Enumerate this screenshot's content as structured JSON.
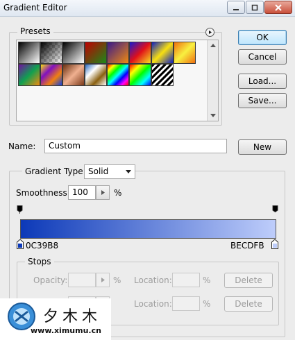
{
  "window": {
    "title": "Gradient Editor",
    "minimize_icon": "minimize-icon",
    "maximize_icon": "maximize-icon",
    "close_icon": "close-icon"
  },
  "presets": {
    "label": "Presets",
    "menu_icon": "flyout-arrow-icon",
    "swatches": [
      {
        "name": "foreground-to-background",
        "colors": [
          "#000000",
          "#ffffff"
        ]
      },
      {
        "name": "foreground-to-transparent",
        "colors": [
          "#000000",
          "transparent"
        ]
      },
      {
        "name": "black-white",
        "colors": [
          "#000000",
          "#ffffff"
        ]
      },
      {
        "name": "red-green",
        "colors": [
          "#c00000",
          "#1a8a1a"
        ]
      },
      {
        "name": "violet-orange",
        "colors": [
          "#3a1a8a",
          "#f08a10"
        ]
      },
      {
        "name": "blue-red-yellow",
        "colors": [
          "#1a1ad0",
          "#e0101a",
          "#f8e020"
        ]
      },
      {
        "name": "blue-yellow-blue",
        "colors": [
          "#1020c0",
          "#f8e010",
          "#1020c0"
        ]
      },
      {
        "name": "orange-yellow-orange",
        "colors": [
          "#f07010",
          "#f8f040",
          "#f07010"
        ]
      },
      {
        "name": "violet-green-orange",
        "colors": [
          "#7010a0",
          "#10a050",
          "#f08a10"
        ]
      },
      {
        "name": "yellow-violet-orange-blue",
        "colors": [
          "#f8e010",
          "#8010c0",
          "#f08010",
          "#1040e0"
        ]
      },
      {
        "name": "copper",
        "colors": [
          "#6a3010",
          "#f0b090",
          "#7a3818"
        ]
      },
      {
        "name": "chrome",
        "colors": [
          "#2a6ac0",
          "#ffffff",
          "#8a6010",
          "#ffffff"
        ]
      },
      {
        "name": "spectrum",
        "colors": [
          "#ff0000",
          "#ffff00",
          "#00ff00",
          "#00ffff",
          "#0000ff",
          "#ff00ff",
          "#ff0000"
        ]
      },
      {
        "name": "transparent-rainbow",
        "colors": [
          "#ff0000",
          "#ffff00",
          "#00ff00",
          "#00ffff",
          "#0000ff"
        ]
      },
      {
        "name": "transparent-stripes",
        "colors": [
          "#000000",
          "#ffffff"
        ]
      }
    ]
  },
  "buttons": {
    "ok": "OK",
    "cancel": "Cancel",
    "load": "Load...",
    "save": "Save...",
    "new": "New",
    "delete_opacity": "Delete",
    "delete_color": "Delete"
  },
  "name_field": {
    "label": "Name:",
    "value": "Custom"
  },
  "gradient_type": {
    "label": "Gradient Type:",
    "value": "Solid"
  },
  "smoothness": {
    "label": "Smoothness:",
    "value": "100",
    "unit": "%"
  },
  "gradient": {
    "start_color": "#0C39B8",
    "end_color": "#BECDFB",
    "start_label": "0C39B8",
    "end_label": "BECDFB"
  },
  "stops": {
    "label": "Stops",
    "opacity_label": "Opacity:",
    "opacity_unit": "%",
    "location_label_1": "Location:",
    "location_unit_1": "%",
    "location_label_2": "Location:",
    "location_unit_2": "%"
  },
  "watermark": {
    "text_cn": "夕木木",
    "url": "www.ximumu.cn"
  }
}
